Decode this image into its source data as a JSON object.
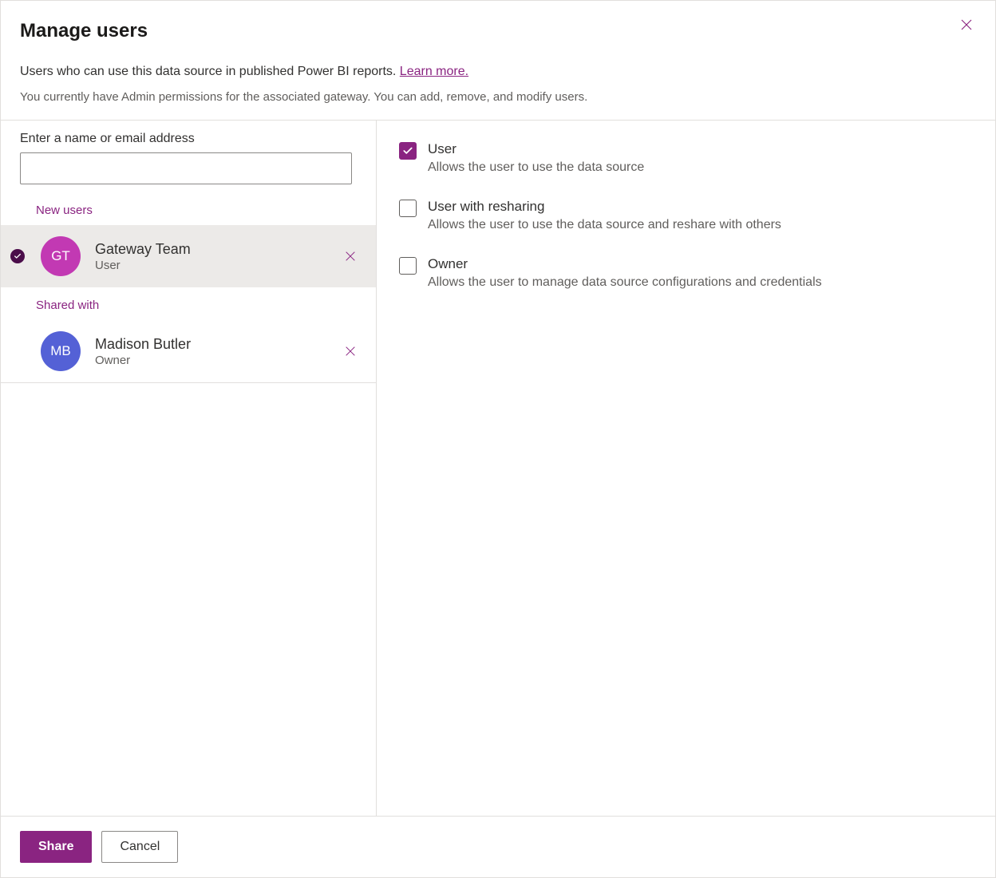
{
  "header": {
    "title": "Manage users",
    "description_prefix": "Users who can use this data source in published Power BI reports. ",
    "learn_more": "Learn more.",
    "sub_description": "You currently have Admin permissions for the associated gateway. You can add, remove, and modify users."
  },
  "left": {
    "search_label": "Enter a name or email address",
    "search_value": "",
    "new_users_label": "New users",
    "shared_with_label": "Shared with",
    "new_users": [
      {
        "initials": "GT",
        "name": "Gateway Team",
        "role": "User",
        "avatar_color": "#c239b3",
        "selected": true
      }
    ],
    "shared_users": [
      {
        "initials": "MB",
        "name": "Madison Butler",
        "role": "Owner",
        "avatar_color": "#5461d6",
        "selected": false
      }
    ]
  },
  "permissions": [
    {
      "key": "user",
      "title": "User",
      "desc": "Allows the user to use the data source",
      "checked": true
    },
    {
      "key": "reshare",
      "title": "User with resharing",
      "desc": "Allows the user to use the data source and reshare with others",
      "checked": false
    },
    {
      "key": "owner",
      "title": "Owner",
      "desc": "Allows the user to manage data source configurations and credentials",
      "checked": false
    }
  ],
  "footer": {
    "share": "Share",
    "cancel": "Cancel"
  }
}
